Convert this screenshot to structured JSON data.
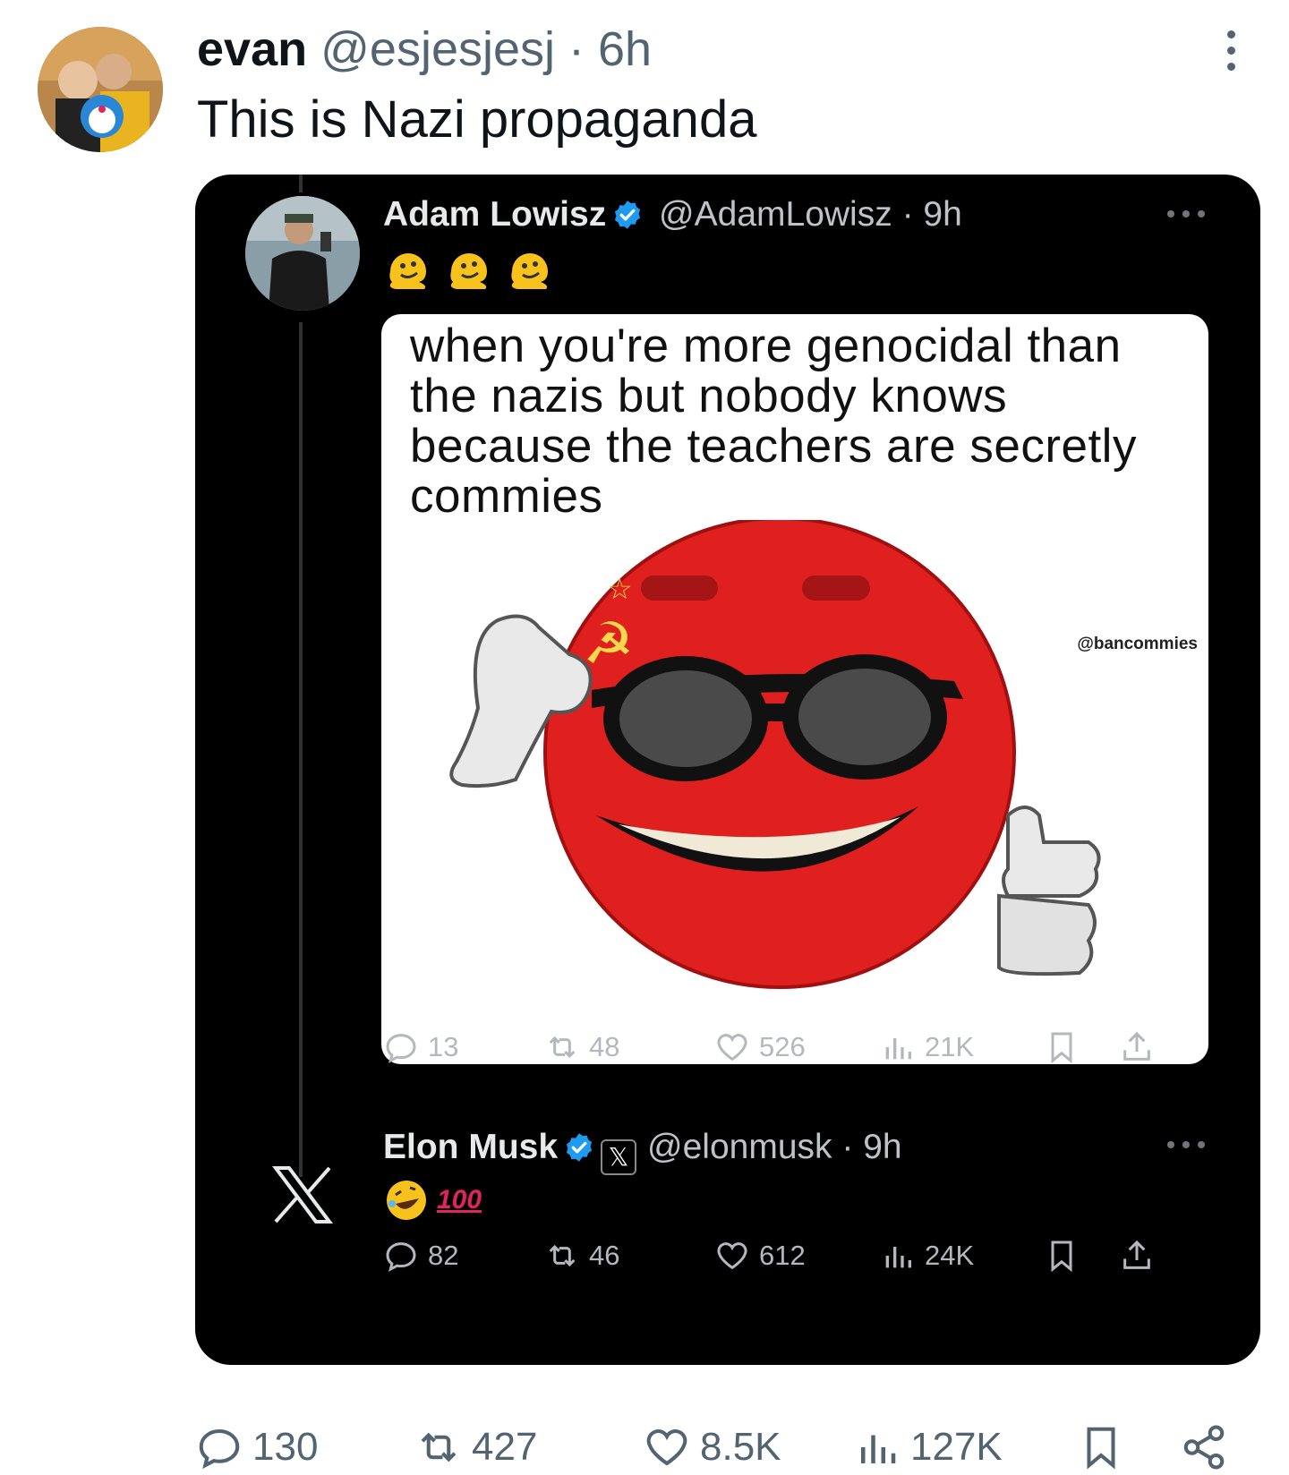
{
  "author": {
    "name": "evan",
    "handle": "@esjesjesj",
    "time": "· 6h"
  },
  "tweet": {
    "text": "This is Nazi propaganda"
  },
  "quoted": {
    "author": {
      "name": "Adam Lowisz",
      "handle": "@AdamLowisz",
      "time": "· 9h"
    },
    "meme": {
      "caption": "when you're more genocidal than the nazis but nobody knows because the teachers are secretly commies",
      "watermark": "@bancommies"
    },
    "stats": {
      "replies": "13",
      "reposts": "48",
      "likes": "526",
      "views": "21K"
    }
  },
  "reply": {
    "author": {
      "name": "Elon Musk",
      "handle": "@elonmusk",
      "time": "· 9h",
      "badge": "𝕏"
    },
    "emoji_text": "100",
    "stats": {
      "replies": "82",
      "reposts": "46",
      "likes": "612",
      "views": "24K"
    }
  },
  "main_stats": {
    "replies": "130",
    "reposts": "427",
    "likes": "8.5K",
    "views": "127K"
  },
  "icons": [
    "reply-icon",
    "repost-icon",
    "like-icon",
    "views-icon",
    "bookmark-icon",
    "share-icon",
    "verified-icon",
    "x-logo-icon",
    "more-icon"
  ],
  "colors": {
    "verified": "#1d9bf0",
    "meme_red": "#e01f1f",
    "secondary_text": "#536471"
  }
}
